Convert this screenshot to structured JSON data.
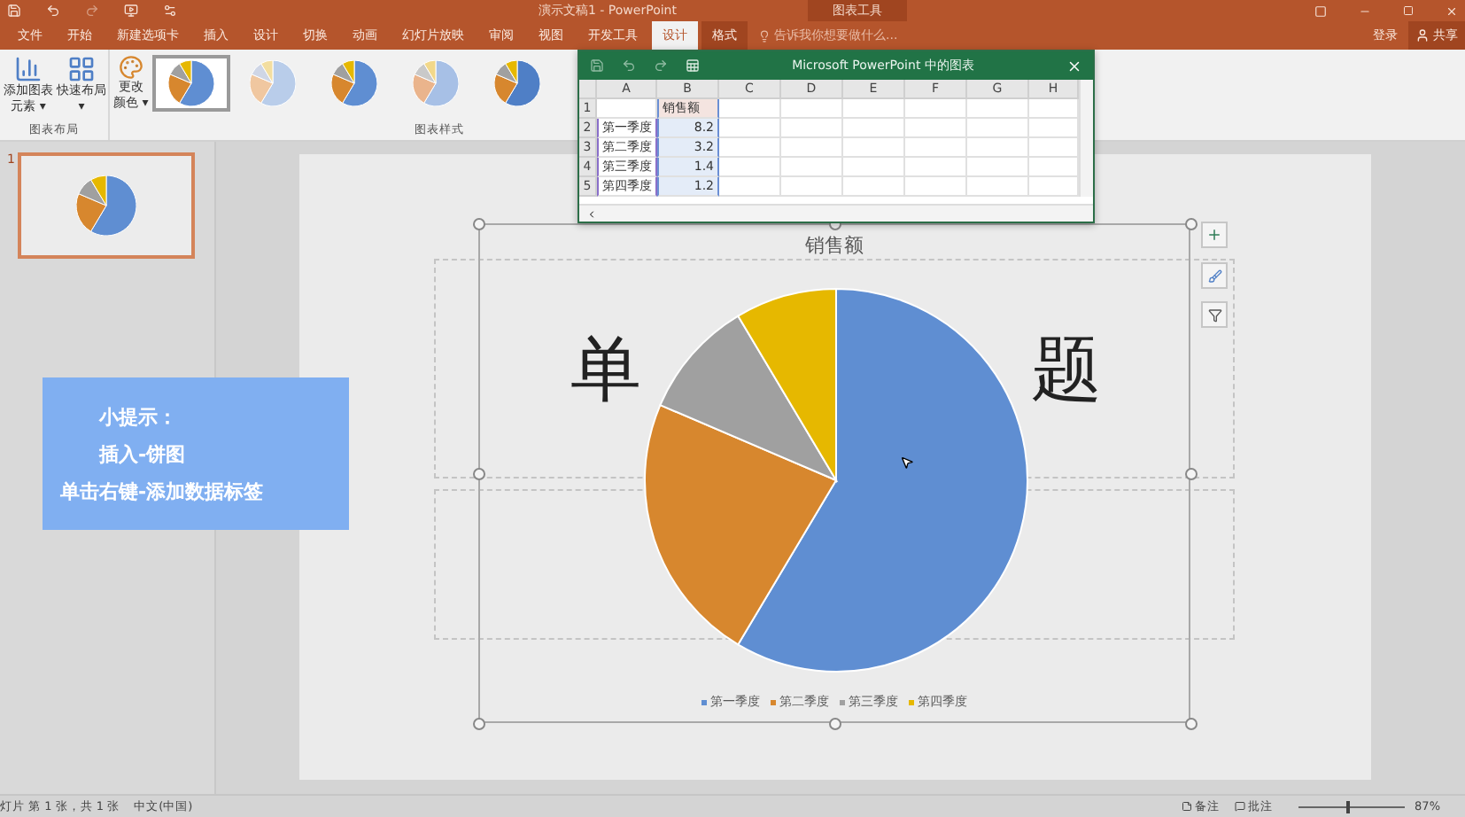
{
  "title_bar": {
    "title": "演示文稿1 - PowerPoint",
    "context_label": "图表工具"
  },
  "tabs": [
    {
      "label": "文件",
      "selected": false,
      "kind": "main"
    },
    {
      "label": "开始",
      "selected": false,
      "kind": "main"
    },
    {
      "label": "新建选项卡",
      "selected": false,
      "kind": "main"
    },
    {
      "label": "插入",
      "selected": false,
      "kind": "main"
    },
    {
      "label": "设计",
      "selected": false,
      "kind": "main"
    },
    {
      "label": "切换",
      "selected": false,
      "kind": "main"
    },
    {
      "label": "动画",
      "selected": false,
      "kind": "main"
    },
    {
      "label": "幻灯片放映",
      "selected": false,
      "kind": "main"
    },
    {
      "label": "审阅",
      "selected": false,
      "kind": "main"
    },
    {
      "label": "视图",
      "selected": false,
      "kind": "main"
    },
    {
      "label": "开发工具",
      "selected": false,
      "kind": "main"
    },
    {
      "label": "设计",
      "selected": true,
      "kind": "context"
    },
    {
      "label": "格式",
      "selected": false,
      "kind": "context"
    }
  ],
  "search": {
    "placeholder": "告诉我你想要做什么..."
  },
  "account": {
    "sign_in": "登录",
    "share": "共享"
  },
  "ribbon": {
    "layout_group": "图表布局",
    "buttons": [
      {
        "lines": [
          "添加图表",
          "元素 ▾"
        ]
      },
      {
        "lines": [
          "快速布局",
          "▾"
        ]
      },
      {
        "lines": [
          "更改",
          "颜色 ▾"
        ]
      }
    ],
    "styles_group": "图表样式",
    "styles": [
      {
        "selected": true
      },
      {
        "selected": false
      },
      {
        "selected": false
      },
      {
        "selected": false
      },
      {
        "selected": false
      }
    ]
  },
  "excel": {
    "title": "Microsoft PowerPoint 中的图表",
    "columns": [
      "A",
      "B",
      "C",
      "D",
      "E",
      "F",
      "G",
      "H"
    ],
    "rows": [
      {
        "number": "1",
        "b": "销售额"
      },
      {
        "number": "2",
        "a": "第一季度",
        "b": "8.2"
      },
      {
        "number": "3",
        "a": "第二季度",
        "b": "3.2"
      },
      {
        "number": "4",
        "a": "第三季度",
        "b": "1.4"
      },
      {
        "number": "5",
        "a": "第四季度",
        "b": "1.2"
      }
    ]
  },
  "slide": {
    "number": "1",
    "title_fragments": [
      "单",
      "题"
    ],
    "chart": {
      "legend": [
        {
          "color": "#5f8ed2"
        },
        {
          "color": "#d7872e"
        },
        {
          "color": "#a0a0a0"
        },
        {
          "color": "#e6b800"
        }
      ],
      "chart_data": {
        "type": "pie",
        "title": "销售额",
        "legend": "bottom",
        "categories": [
          "第一季度",
          "第二季度",
          "第三季度",
          "第四季度"
        ],
        "series": [
          {
            "values": [
              58.57,
              22.86,
              10,
              8.57
            ]
          }
        ]
      }
    }
  },
  "tip": {
    "lines": [
      "小提示：",
      "插入-饼图",
      "单击右键-添加数据标签"
    ]
  },
  "status_bar": {
    "slide_info": "灯片 第 1 张，共 1 张",
    "language": "中文(中国)",
    "notes": "备注",
    "comments": "批注",
    "zoom": "87%",
    "zoom_slider": {
      "level": 0.46
    }
  }
}
